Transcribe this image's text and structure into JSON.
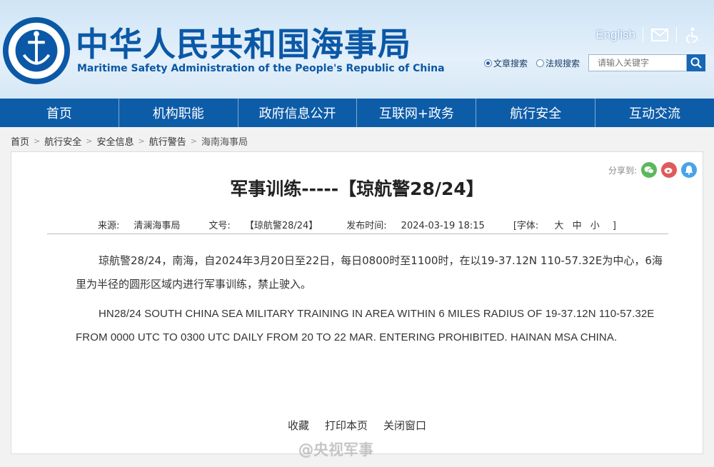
{
  "header": {
    "title_cn": "中华人民共和国海事局",
    "title_en": "Maritime Safety Administration of the People's Republic of China",
    "logo_text_cn": "中国海事局",
    "logo_text_en": "CHINA MSA",
    "english_link": "English",
    "search": {
      "option_article": "文章搜索",
      "option_law": "法规搜索",
      "placeholder": "请输入关键字"
    }
  },
  "nav": {
    "items": [
      "首页",
      "机构职能",
      "政府信息公开",
      "互联网+政务",
      "航行安全",
      "互动交流"
    ]
  },
  "breadcrumb": [
    "首页",
    "航行安全",
    "安全信息",
    "航行警告",
    "海南海事局"
  ],
  "article": {
    "share_label": "分享到:",
    "title": "军事训练-----【琼航警28/24】",
    "meta": {
      "source_label": "来源:",
      "source": "清澜海事局",
      "doc_label": "文号:",
      "doc": "【琼航警28/24】",
      "time_label": "发布时间:",
      "time": "2024-03-19 18:15",
      "font_label": "[字体:",
      "font_l": "大",
      "font_m": "中",
      "font_s": "小",
      "font_end": "]"
    },
    "para_cn": "琼航警28/24，南海，自2024年3月20日至22日，每日0800时至1100时，在以19-37.12N 110-57.32E为中心，6海里为半径的圆形区域内进行军事训练，禁止驶入。",
    "para_en": "HN28/24 SOUTH CHINA SEA MILITARY TRAINING IN AREA WITHIN 6 MILES RADIUS OF 19-37.12N 110-57.32E  FROM 0000 UTC TO 0300 UTC DAILY FROM 20 TO 22 MAR. ENTERING PROHIBITED. HAINAN MSA CHINA.",
    "actions": [
      "收藏",
      "打印本页",
      "关闭窗口"
    ]
  },
  "watermark": "@央视军事",
  "colors": {
    "brand_blue": "#0d5ca8",
    "title_blue": "#0b58a6"
  }
}
